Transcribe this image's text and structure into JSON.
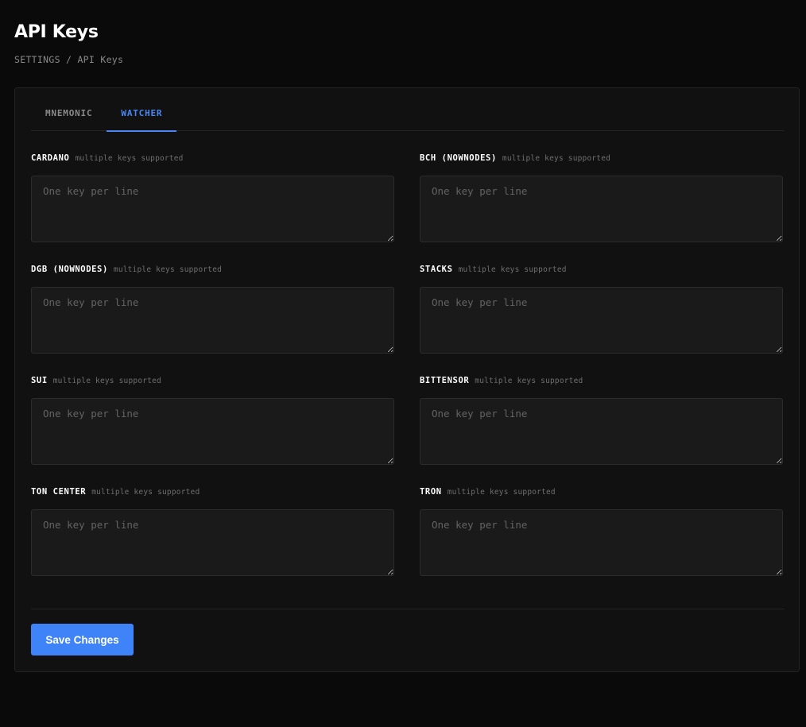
{
  "page": {
    "title": "API Keys",
    "breadcrumb": "SETTINGS / API Keys"
  },
  "tabs": [
    {
      "label": "MNEMONIC",
      "active": false
    },
    {
      "label": "WATCHER",
      "active": true
    }
  ],
  "fields": [
    {
      "name": "CARDANO",
      "hint": "multiple keys supported",
      "placeholder": "One key per line",
      "value": ""
    },
    {
      "name": "BCH (NOWNODES)",
      "hint": "multiple keys supported",
      "placeholder": "One key per line",
      "value": ""
    },
    {
      "name": "DGB (NOWNODES)",
      "hint": "multiple keys supported",
      "placeholder": "One key per line",
      "value": ""
    },
    {
      "name": "STACKS",
      "hint": "multiple keys supported",
      "placeholder": "One key per line",
      "value": ""
    },
    {
      "name": "SUI",
      "hint": "multiple keys supported",
      "placeholder": "One key per line",
      "value": ""
    },
    {
      "name": "BITTENSOR",
      "hint": "multiple keys supported",
      "placeholder": "One key per line",
      "value": ""
    },
    {
      "name": "TON CENTER",
      "hint": "multiple keys supported",
      "placeholder": "One key per line",
      "value": ""
    },
    {
      "name": "TRON",
      "hint": "multiple keys supported",
      "placeholder": "One key per line",
      "value": ""
    }
  ],
  "actions": {
    "save_label": "Save Changes"
  },
  "colors": {
    "accent": "#3f83f8",
    "background": "#0a0a0a",
    "card": "#111111"
  }
}
